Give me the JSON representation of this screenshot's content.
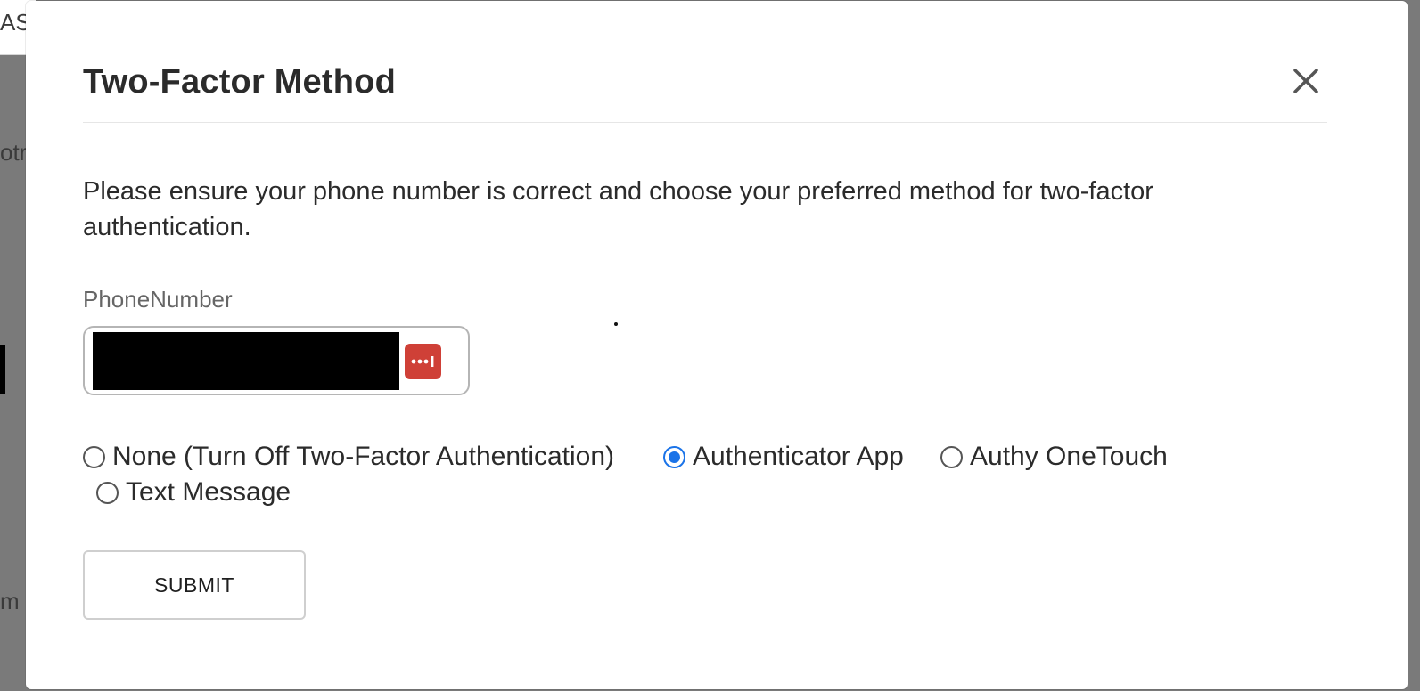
{
  "background": {
    "top_text": "ASS",
    "mid_text": "otru",
    "bottom_text": "m"
  },
  "modal": {
    "title": "Two-Factor Method",
    "close_icon": "close-icon",
    "description": "Please ensure your phone number is correct and choose your preferred method for two-factor authentication.",
    "phone": {
      "label": "PhoneNumber",
      "value": "",
      "password_manager_icon": "password-manager-icon"
    },
    "methods": [
      {
        "label": "None (Turn Off Two-Factor Authentication)",
        "checked": false
      },
      {
        "label": "Authenticator App",
        "checked": true
      },
      {
        "label": "Authy OneTouch",
        "checked": false
      },
      {
        "label": "Text Message",
        "checked": false
      }
    ],
    "submit_label": "SUBMIT"
  },
  "colors": {
    "accent": "#1a73e8",
    "password_manager": "#cf4037"
  }
}
